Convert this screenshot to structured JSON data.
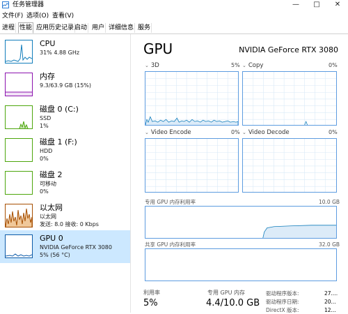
{
  "window": {
    "title": "任务管理器",
    "minimize": "—",
    "maximize": "□",
    "close": "✕"
  },
  "menu": [
    "文件(F)",
    "选项(O)",
    "查看(V)"
  ],
  "tabs": [
    "进程",
    "性能",
    "应用历史记录",
    "启动",
    "用户",
    "详细信息",
    "服务"
  ],
  "active_tab": "性能",
  "colors": {
    "cpu": "#117dbb",
    "memory": "#8b12ae",
    "disk": "#4da60c",
    "ethernet": "#a74f01",
    "gpu": "#0d5ba8",
    "selected_bg": "#cce8ff"
  },
  "sidebar": [
    {
      "name": "CPU",
      "line1": "31% 4.88 GHz",
      "line2": ""
    },
    {
      "name": "内存",
      "line1": "9.3/63.9 GB (15%)",
      "line2": ""
    },
    {
      "name": "磁盘 0 (C:)",
      "line1": "SSD",
      "line2": "1%"
    },
    {
      "name": "磁盘 1 (F:)",
      "line1": "HDD",
      "line2": "0%"
    },
    {
      "name": "磁盘 2",
      "line1": "可移动",
      "line2": "0%"
    },
    {
      "name": "以太网",
      "line1": "以太网",
      "line2": "发送: 8.0 接收: 0 Kbps"
    },
    {
      "name": "GPU 0",
      "line1": "NVIDIA GeForce RTX 3080",
      "line2": "5% (56 °C)"
    }
  ],
  "main": {
    "title": "GPU",
    "model": "NVIDIA GeForce RTX 3080",
    "engines": [
      {
        "label": "3D",
        "pct": "5%"
      },
      {
        "label": "Copy",
        "pct": "0%"
      },
      {
        "label": "Video Encode",
        "pct": "0%"
      },
      {
        "label": "Video Decode",
        "pct": "0%"
      }
    ],
    "dedicated": {
      "label": "专用 GPU 内存利用率",
      "max": "10.0 GB"
    },
    "shared": {
      "label": "共享 GPU 内存利用率",
      "max": "32.0 GB"
    },
    "stats": {
      "util_label": "利用率",
      "util_value": "5%",
      "dedicated_label": "专用 GPU 内存",
      "dedicated_value": "4.4/10.0 GB"
    },
    "info": [
      {
        "label": "驱动程序版本:",
        "value": "27...."
      },
      {
        "label": "驱动程序日期:",
        "value": "20..."
      },
      {
        "label": "DirectX 版本:",
        "value": "12..."
      }
    ]
  }
}
